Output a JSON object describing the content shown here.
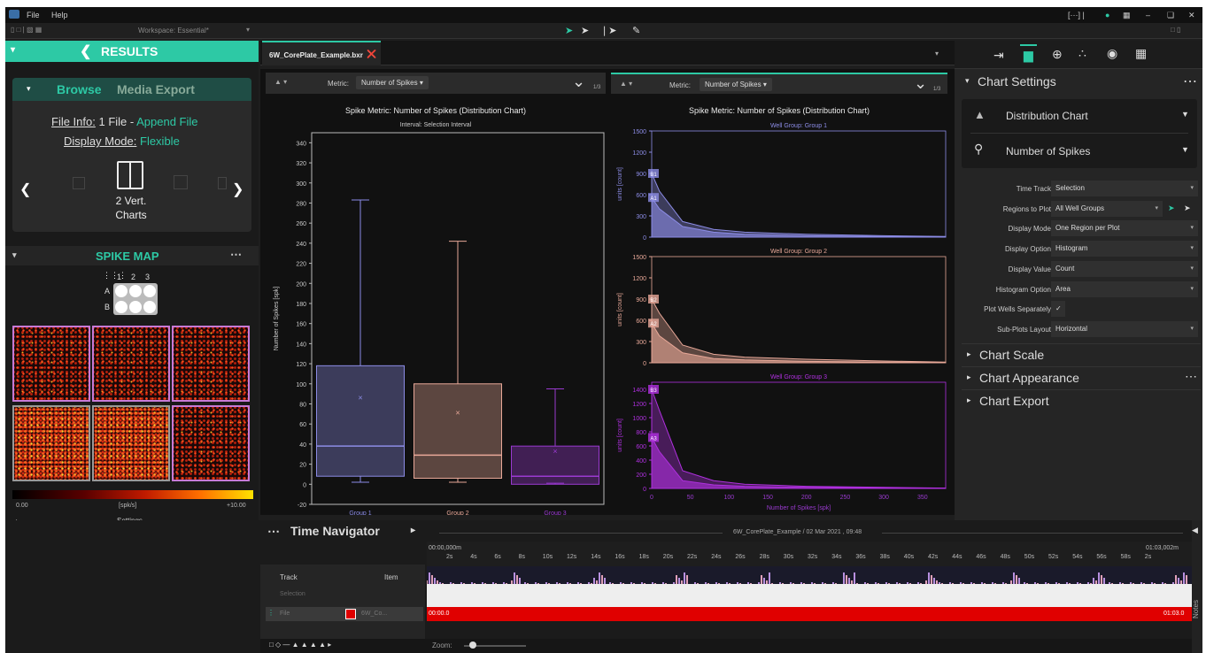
{
  "menu": {
    "app_icon": "axis-logo-icon",
    "file": "File",
    "help": "Help",
    "window_status": "[···] |"
  },
  "toolbar": {
    "workspace": "Workspace: Essential*"
  },
  "left": {
    "results_title": "RESULTS",
    "browse": "Browse",
    "media_export": "Media Export",
    "file_info_label": "File Info:",
    "file_info_value": "1 File -",
    "append_file": "Append File",
    "display_mode_label": "Display Mode:",
    "display_mode_value": "Flexible",
    "layout_selected_line1": "2 Vert.",
    "layout_selected_line2": "Charts",
    "spike_map_title": "SPIKE MAP",
    "plate_cols": [
      "1",
      "2",
      "3"
    ],
    "plate_rows": [
      "A",
      "B"
    ],
    "colorbar_min": "0.00",
    "colorbar_unit": "[spk/s]",
    "colorbar_max": "+10.00",
    "settings": "Settings",
    "heat_accent_selected": "#c77ad6"
  },
  "tab": {
    "label": "6W_CorePlate_Example.bxr"
  },
  "left_chart": {
    "metric_label": "Metric:",
    "metric_value": "Number of Spikes",
    "page": "1/3",
    "title": "Spike Metric: Number of Spikes (Distribution Chart)",
    "subtitle": "Interval: Selection Interval"
  },
  "right_chart": {
    "metric_label": "Metric:",
    "metric_value": "Number of Spikes",
    "page": "1/3",
    "title": "Spike Metric: Number of Spikes (Distribution Chart)"
  },
  "chart_data": [
    {
      "type": "box",
      "ylabel": "Number of Spikes [spk]",
      "ylim": [
        -20,
        350
      ],
      "yticks": [
        -20,
        0,
        20,
        40,
        60,
        80,
        100,
        120,
        140,
        160,
        180,
        200,
        220,
        240,
        260,
        280,
        300,
        320,
        340
      ],
      "categories": [
        "Group 1",
        "Group 2",
        "Group 3"
      ],
      "colors": [
        "#8c8ce6",
        "#e8a898",
        "#9a3ad0"
      ],
      "series": [
        {
          "min": 2,
          "q1": 8,
          "median": 38,
          "q3": 118,
          "max": 283,
          "mean": 86
        },
        {
          "min": 2,
          "q1": 6,
          "median": 29,
          "q3": 100,
          "max": 242,
          "mean": 71
        },
        {
          "min": 1,
          "q1": 0,
          "median": 8,
          "q3": 38,
          "max": 95,
          "mean": 33
        }
      ]
    },
    {
      "type": "area",
      "xlabel": "Number of Spikes [spk]",
      "ylabel": "units [count]",
      "xlim": [
        0,
        380
      ],
      "xticks": [
        0,
        50,
        100,
        150,
        200,
        250,
        300,
        350
      ],
      "subplots": [
        {
          "title": "Well Group: Group 1",
          "color": "#8c8ce6",
          "ylim": [
            0,
            1500
          ],
          "yticks": [
            0,
            300,
            600,
            900,
            1200,
            1500
          ],
          "markers": [
            {
              "label": "B1",
              "y": 900
            },
            {
              "label": "A1",
              "y": 560
            }
          ],
          "series": [
            {
              "name": "B1",
              "x": [
                0,
                10,
                40,
                80,
                120,
                200,
                300,
                380
              ],
              "values": [
                900,
                650,
                220,
                110,
                70,
                40,
                20,
                10
              ]
            },
            {
              "name": "A1",
              "x": [
                0,
                10,
                40,
                80,
                120,
                200,
                300,
                380
              ],
              "values": [
                560,
                400,
                150,
                70,
                40,
                20,
                10,
                5
              ]
            }
          ]
        },
        {
          "title": "Well Group: Group 2",
          "color": "#e8a898",
          "ylim": [
            0,
            1500
          ],
          "yticks": [
            0,
            300,
            600,
            900,
            1200,
            1500
          ],
          "markers": [
            {
              "label": "B2",
              "y": 900
            },
            {
              "label": "A2",
              "y": 560
            }
          ],
          "series": [
            {
              "name": "B2",
              "x": [
                0,
                10,
                40,
                80,
                120,
                200,
                300,
                380
              ],
              "values": [
                900,
                700,
                250,
                120,
                80,
                50,
                25,
                10
              ]
            },
            {
              "name": "A2",
              "x": [
                0,
                10,
                40,
                80,
                120,
                200,
                300,
                380
              ],
              "values": [
                560,
                380,
                140,
                60,
                40,
                20,
                10,
                5
              ]
            }
          ]
        },
        {
          "title": "Well Group: Group 3",
          "color": "#b030e0",
          "ylim": [
            0,
            1500
          ],
          "yticks": [
            0,
            200,
            400,
            600,
            800,
            1000,
            1200,
            1400
          ],
          "markers": [
            {
              "label": "B3",
              "y": 1400
            },
            {
              "label": "A3",
              "y": 720
            }
          ],
          "series": [
            {
              "name": "B3",
              "x": [
                0,
                10,
                40,
                80,
                120,
                200,
                300,
                380
              ],
              "values": [
                1400,
                1100,
                250,
                110,
                60,
                30,
                15,
                5
              ]
            },
            {
              "name": "A3",
              "x": [
                0,
                10,
                40,
                80,
                120,
                200,
                300,
                380
              ],
              "values": [
                720,
                520,
                110,
                50,
                30,
                15,
                8,
                3
              ]
            }
          ]
        }
      ]
    }
  ],
  "right": {
    "chart_settings": "Chart Settings",
    "chart_type": "Distribution Chart",
    "metric": "Number of Spikes",
    "props": [
      {
        "label": "Time Track",
        "value": "Selection"
      },
      {
        "label": "Regions to Plot",
        "value": "All Well Groups"
      },
      {
        "label": "Display Mode",
        "value": "One Region per Plot"
      },
      {
        "label": "Display Option",
        "value": "Histogram"
      },
      {
        "label": "Display Value",
        "value": "Count"
      },
      {
        "label": "Histogram Option",
        "value": "Area"
      },
      {
        "label": "Plot Wells Separately",
        "value": "✓"
      },
      {
        "label": "Sub-Plots Layout",
        "value": "Horizontal"
      }
    ],
    "chart_scale": "Chart Scale",
    "chart_appearance": "Chart Appearance",
    "chart_export": "Chart Export"
  },
  "bottom": {
    "time_navigator": "Time Navigator",
    "file_caption": "6W_CorePlate_Example / 02 Mar 2021 , 09:48",
    "start": "00:00,000m",
    "end": "01:03,002m",
    "ticks": [
      "2s",
      "4s",
      "6s",
      "8s",
      "10s",
      "12s",
      "14s",
      "16s",
      "18s",
      "20s",
      "22s",
      "24s",
      "26s",
      "28s",
      "30s",
      "32s",
      "34s",
      "36s",
      "38s",
      "40s",
      "42s",
      "44s",
      "46s",
      "48s",
      "50s",
      "52s",
      "54s",
      "56s",
      "58s",
      "2s"
    ],
    "track_header": "Track",
    "item_header": "Item",
    "selection_row": "Selection",
    "file_row": "File",
    "file_item": "6W_Co...",
    "bar_start": "00:00.0",
    "bar_end": "01:03.0",
    "zoom": "Zoom:",
    "notes": "Notes"
  }
}
